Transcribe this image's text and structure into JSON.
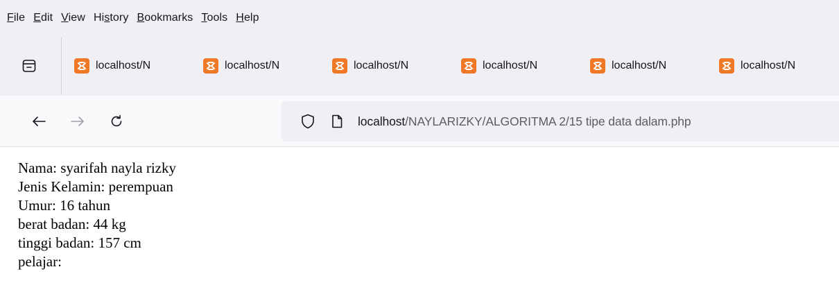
{
  "menubar": {
    "items": [
      {
        "accel": "F",
        "rest": "ile"
      },
      {
        "accel": "E",
        "rest": "dit"
      },
      {
        "accel": "V",
        "rest": "iew"
      },
      {
        "pre": "Hi",
        "accel": "s",
        "rest": "tory"
      },
      {
        "accel": "B",
        "rest": "ookmarks"
      },
      {
        "accel": "T",
        "rest": "ools"
      },
      {
        "accel": "H",
        "rest": "elp"
      }
    ]
  },
  "tabs": [
    {
      "label": "localhost/N",
      "icon": "xampp-icon"
    },
    {
      "label": "localhost/N",
      "icon": "xampp-icon"
    },
    {
      "label": "localhost/N",
      "icon": "xampp-icon"
    },
    {
      "label": "localhost/N",
      "icon": "xampp-icon"
    },
    {
      "label": "localhost/N",
      "icon": "xampp-icon"
    },
    {
      "label": "localhost/N",
      "icon": "xampp-icon"
    }
  ],
  "urlbar": {
    "host": "localhost",
    "path": "/NAYLARIZKY/ALGORITMA 2/15 tipe data dalam.php"
  },
  "content": {
    "lines": [
      "Nama: syarifah nayla rizky",
      "Jenis Kelamin: perempuan",
      "Umur: 16 tahun",
      "berat badan: 44 kg",
      "tinggi badan: 157 cm",
      "pelajar:"
    ]
  },
  "colors": {
    "chrome_bg": "#f0f0f4",
    "navbar_bg": "#f9f9fb",
    "favicon_orange": "#f07826",
    "url_path_gray": "#5b5b66"
  }
}
